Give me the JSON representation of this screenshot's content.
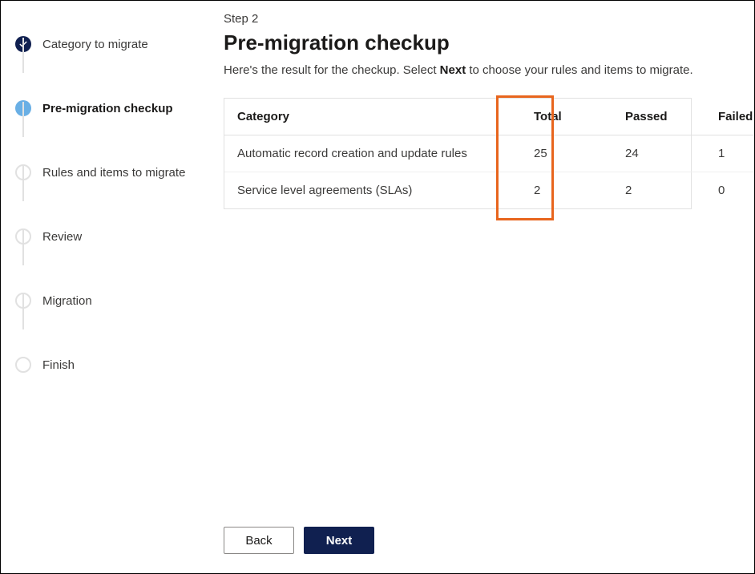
{
  "stepper": {
    "steps": [
      {
        "label": "Category to migrate",
        "state": "completed"
      },
      {
        "label": "Pre-migration checkup",
        "state": "current"
      },
      {
        "label": "Rules and items to migrate",
        "state": "pending"
      },
      {
        "label": "Review",
        "state": "pending"
      },
      {
        "label": "Migration",
        "state": "pending"
      },
      {
        "label": "Finish",
        "state": "pending"
      }
    ]
  },
  "content": {
    "step_indicator": "Step 2",
    "title": "Pre-migration checkup",
    "description_pre": "Here's the result for the checkup. Select ",
    "description_kw": "Next",
    "description_post": " to choose your rules and items to migrate."
  },
  "table": {
    "headers": {
      "category": "Category",
      "total": "Total",
      "passed": "Passed",
      "failed": "Failed"
    },
    "rows": [
      {
        "category": "Automatic record creation and update rules",
        "total": "25",
        "passed": "24",
        "failed": "1"
      },
      {
        "category": "Service level agreements (SLAs)",
        "total": "2",
        "passed": "2",
        "failed": "0"
      }
    ]
  },
  "footer": {
    "back": "Back",
    "next": "Next"
  }
}
